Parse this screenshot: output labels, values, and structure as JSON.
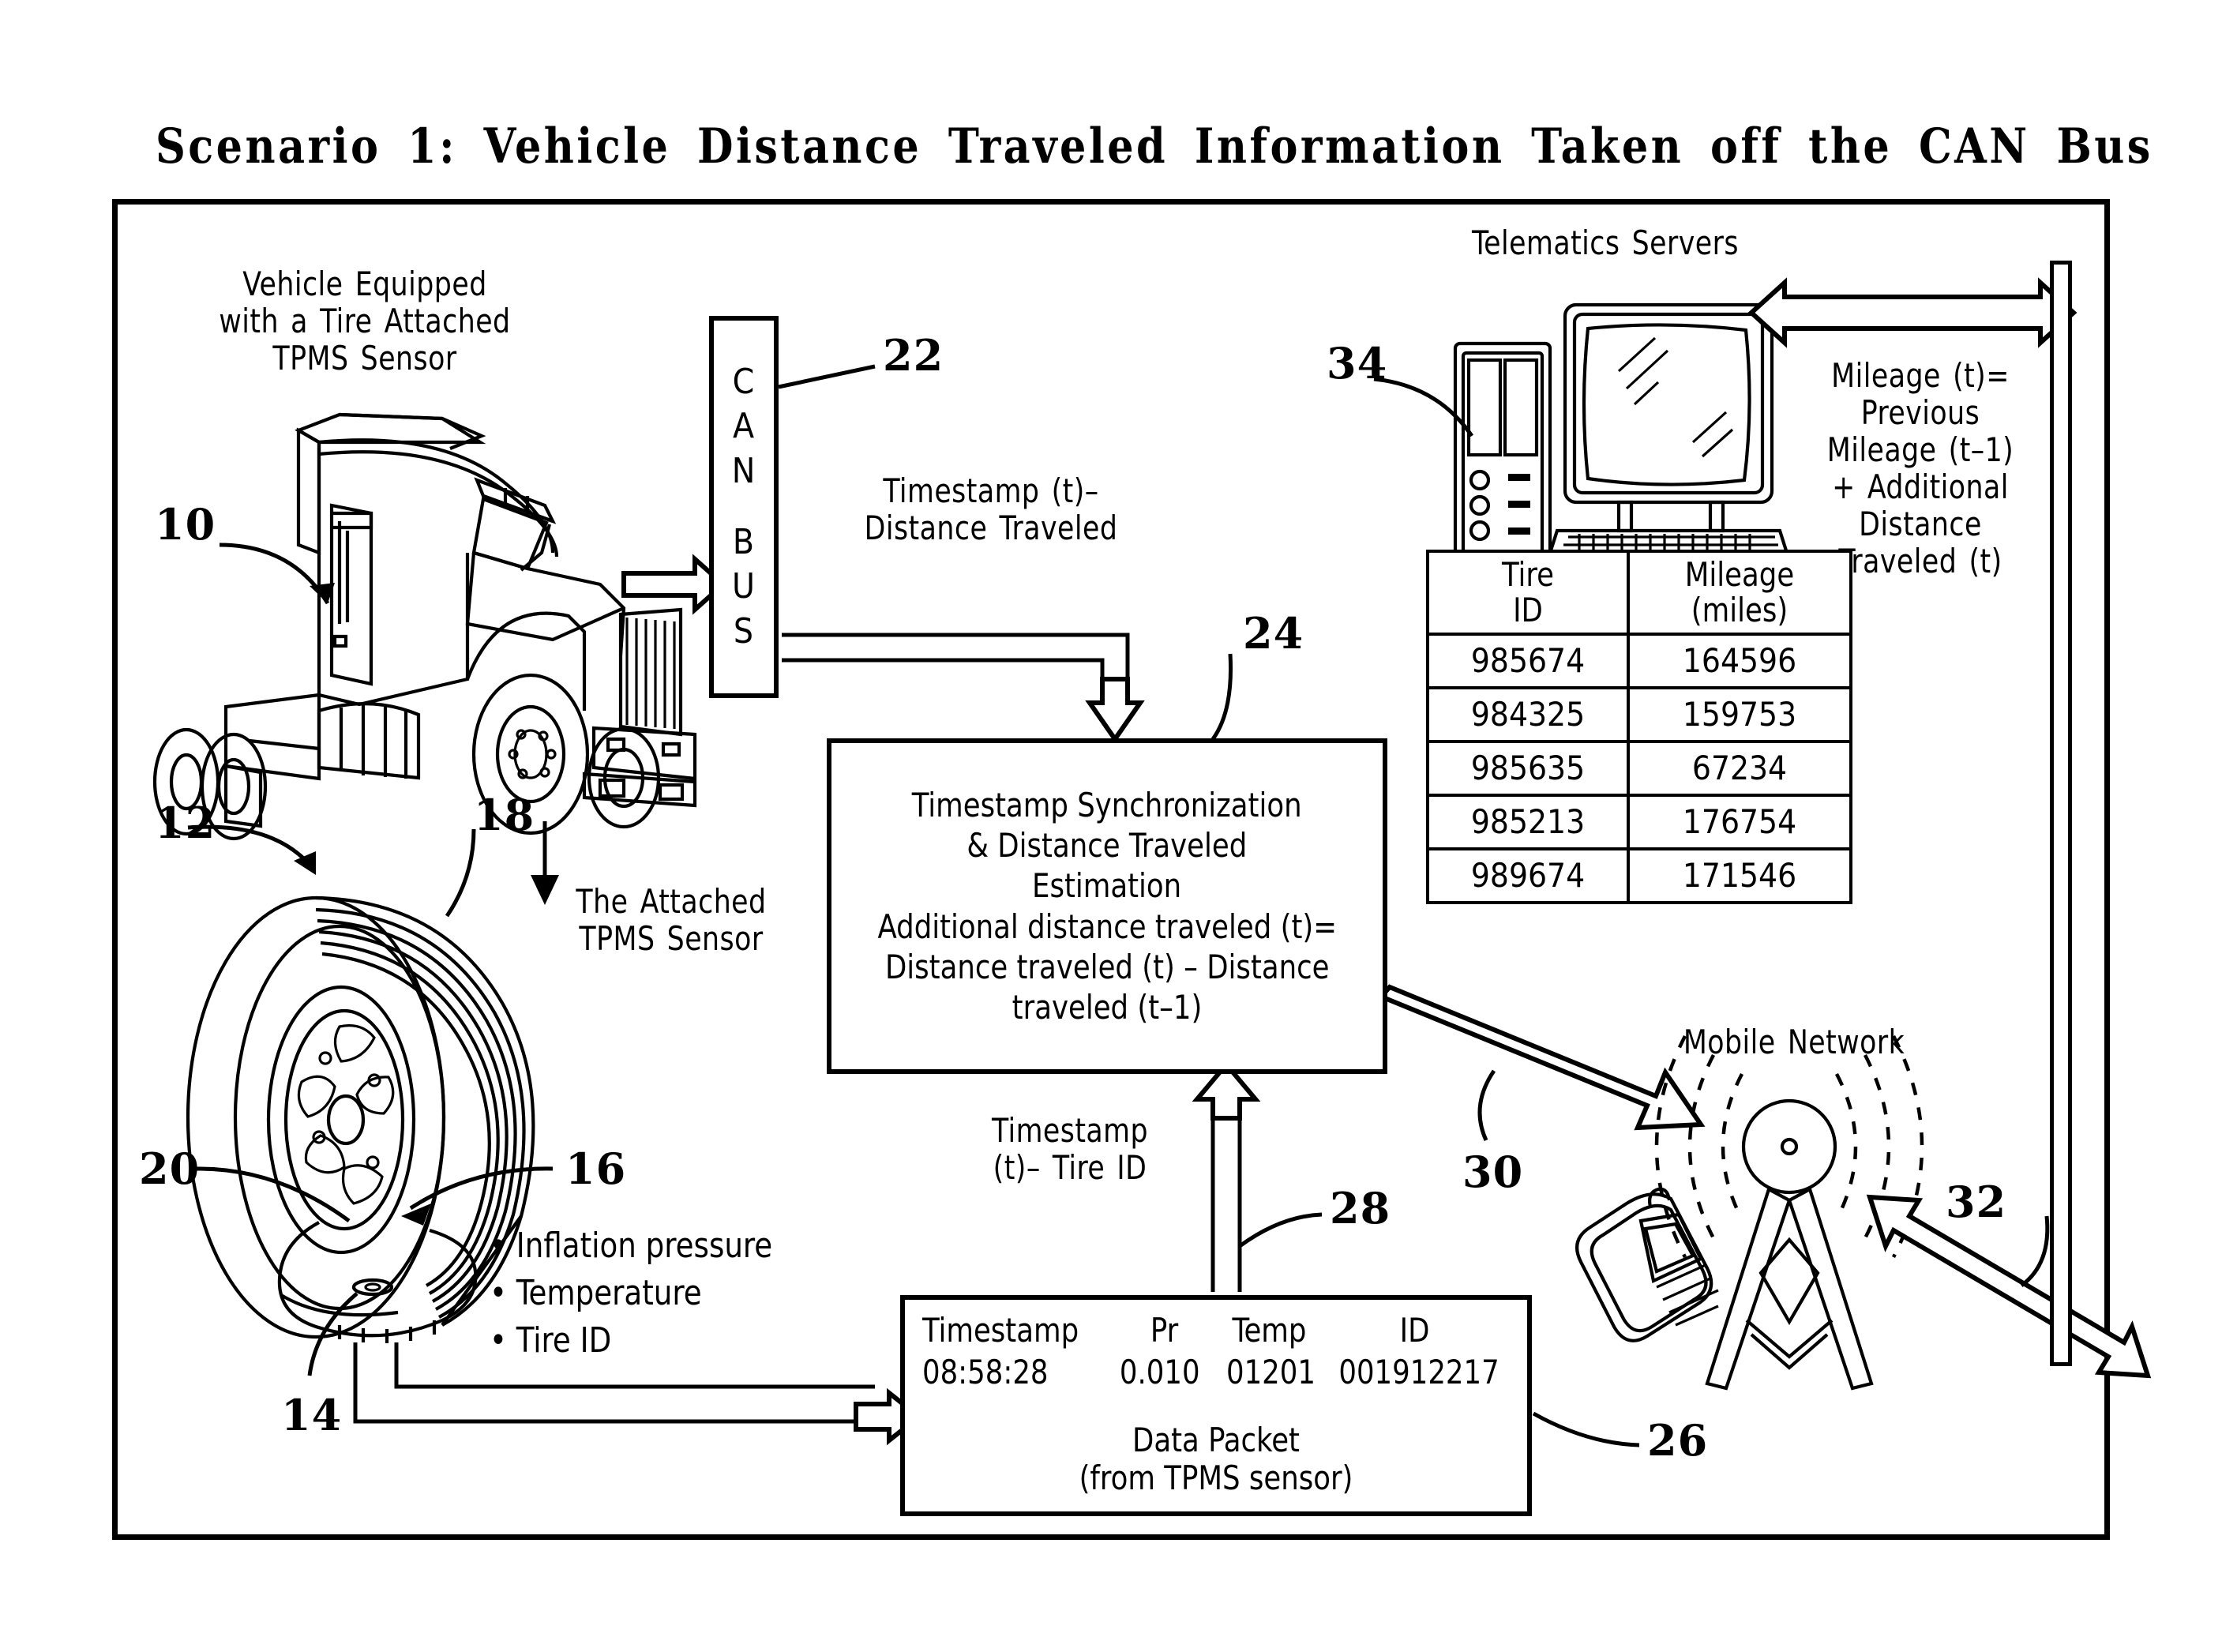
{
  "title": "Scenario  1:  Vehicle  Distance  Traveled  Information  Taken  off  the  CAN  Bus",
  "labels": {
    "vehicle": "Vehicle  Equipped\nwith  a  Tire  Attached\nTPMS  Sensor",
    "attached_sensor": "The  Attached\nTPMS  Sensor",
    "telematics_servers": "Telematics  Servers",
    "mobile_network": "Mobile  Network",
    "timestamp_distance": "Timestamp  (t)–\nDistance  Traveled",
    "timestamp_tireid": "Timestamp\n(t)–  Tire  ID",
    "mileage_formula": "Mileage  (t)=\nPrevious\nMileage  (t–1)\n+  Additional\nDistance\nTraveled  (t)"
  },
  "canbus": {
    "letters": [
      "C",
      "A",
      "N",
      "",
      "B",
      "U",
      "S"
    ]
  },
  "process_box": {
    "lines": [
      "Timestamp  Synchronization",
      "&  Distance  Traveled",
      "Estimation",
      "Additional  distance  traveled  (t)=",
      "Distance  traveled  (t)  –  Distance",
      "traveled  (t–1)"
    ]
  },
  "data_packet": {
    "headers": [
      "Timestamp",
      "Pr",
      "Temp",
      "ID"
    ],
    "values": [
      "08:58:28",
      "0.010",
      "01201",
      "001912217"
    ],
    "caption_line1": "Data  Packet",
    "caption_line2": "(from  TPMS  sensor)"
  },
  "sensor_outputs": [
    "Inflation  pressure",
    "Temperature",
    "Tire  ID"
  ],
  "mileage_table": {
    "headers": [
      "Tire\nID",
      "Mileage\n(miles)"
    ],
    "header_col1_line1": "Tire",
    "header_col1_line2": "ID",
    "header_col2_line1": "Mileage",
    "header_col2_line2": "(miles)",
    "rows": [
      {
        "tire_id": "985674",
        "mileage": "164596"
      },
      {
        "tire_id": "984325",
        "mileage": "159753"
      },
      {
        "tire_id": "985635",
        "mileage": "67234"
      },
      {
        "tire_id": "985213",
        "mileage": "176754"
      },
      {
        "tire_id": "989674",
        "mileage": "171546"
      }
    ]
  },
  "reference_numerals": {
    "n10": "10",
    "n12": "12",
    "n14": "14",
    "n16": "16",
    "n18": "18",
    "n20": "20",
    "n22": "22",
    "n24": "24",
    "n26": "26",
    "n28": "28",
    "n30": "30",
    "n32": "32",
    "n34": "34"
  },
  "colors": {
    "ink": "#000000",
    "paper": "#ffffff"
  }
}
